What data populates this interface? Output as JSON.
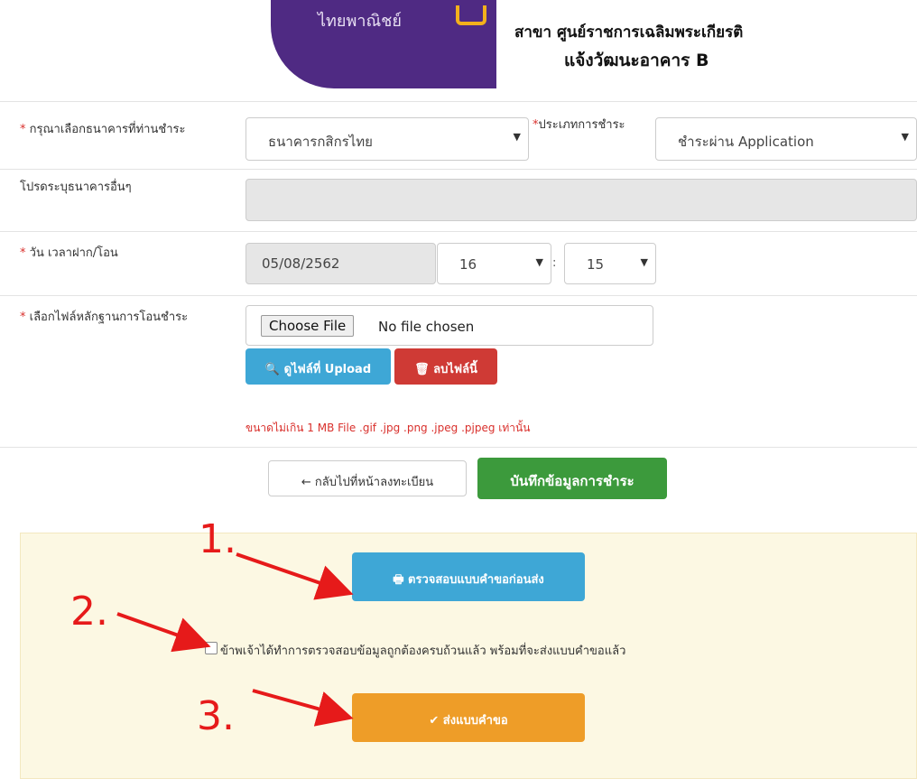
{
  "header": {
    "logo_text": "ไทยพาณิชย์",
    "branch_line1": "สาขา  ศูนย์ราชการเฉลิมพระเกียรติ",
    "branch_line2": "แจ้งวัฒนะอาคาร B"
  },
  "form": {
    "bank_label": "กรุณาเลือกธนาคารที่ท่านชำระ",
    "bank_value": "ธนาคารกสิกรไทย",
    "payment_type_label": "ประเภทการชำระ",
    "payment_type_value": "ชำระผ่าน Application",
    "other_bank_label": "โปรดระบุธนาคารอื่นๆ",
    "datetime_label": "วัน เวลาฝาก/โอน",
    "date_value": "05/08/2562",
    "hour_value": "16",
    "time_sep": ":",
    "minute_value": "15",
    "file_label": "เลือกไฟล์หลักฐานการโอนชำระ",
    "choose_file": "Choose File",
    "no_file": "No file chosen",
    "view_upload": "ดูไฟล์ที่ Upload",
    "delete_file": "ลบไฟล์นี้",
    "file_hint": "ขนาดไม่เกิน 1 MB File .gif .jpg .png .jpeg .pjpeg เท่านั้น",
    "back_button": "กลับไปที่หน้าลงทะเบียน",
    "save_button": "บันทึกข้อมูลการชำระ",
    "required_mark": "*"
  },
  "confirm": {
    "check_button": "ตรวจสอบแบบคำขอก่อนส่ง",
    "checkbox_label": "ข้าพเจ้าได้ทำการตรวจสอบข้อมูลถูกต้องครบถ้วนแล้ว พร้อมที่จะส่งแบบคำขอแล้ว",
    "submit_button": "ส่งแบบคำขอ"
  },
  "annotations": [
    "1.",
    "2.",
    "3."
  ],
  "colors": {
    "primary_purple": "#4f2a83",
    "info": "#3ea7d6",
    "danger": "#cf3a35",
    "success": "#3c9a3c",
    "warning": "#ee9d28",
    "annotation_red": "#e61a1a"
  }
}
